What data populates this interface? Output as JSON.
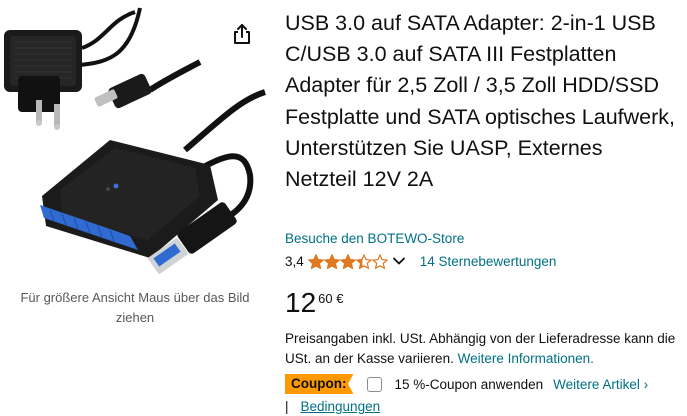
{
  "product": {
    "title": "USB 3.0 auf SATA Adapter: 2-in-1 USB C/USB 3.0 auf SATA III Festplatten Adapter für 2,5 Zoll / 3,5 Zoll HDD/SSD Festplatte und SATA optisches Laufwerk, Unterstützen Sie UASP, Externes Netzteil 12V 2A",
    "store_link": "Besuche den BOTEWO-Store",
    "rating_value": "3,4",
    "rating_stars": 3.4,
    "ratings_count": "14 Sternebewertungen"
  },
  "image": {
    "hover_hint": "Für größere Ansicht Maus über das Bild ziehen"
  },
  "price": {
    "whole": "12",
    "fraction": "60 €"
  },
  "tax": {
    "text": "Preisangaben inkl. USt. Abhängig von der Lieferadresse kann die USt. an der Kasse variieren.",
    "link": "Weitere Informationen."
  },
  "coupon": {
    "badge": "Coupon:",
    "label": "15 %-Coupon anwenden",
    "more_link": "Weitere Artikel ›",
    "separator": "|",
    "conditions_link": "Bedingungen"
  },
  "colors": {
    "link": "#007185",
    "star": "#de7921",
    "coupon_badge": "#ff9900"
  },
  "icons": {
    "share": "share-icon",
    "chevron": "chevron-down-icon"
  }
}
